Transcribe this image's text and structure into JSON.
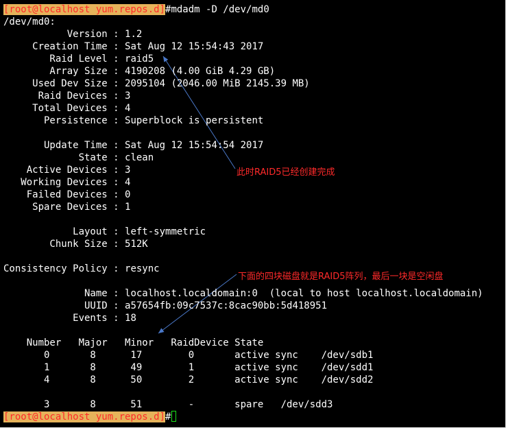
{
  "prompt": {
    "text": "[root@localhost yum.repos.d]",
    "symbol": "#"
  },
  "command": "mdadm -D /dev/md0",
  "device_header": "/dev/md0:",
  "details": [
    {
      "key": "Version",
      "value": "1.2"
    },
    {
      "key": "Creation Time",
      "value": "Sat Aug 12 15:54:43 2017"
    },
    {
      "key": "Raid Level",
      "value": "raid5"
    },
    {
      "key": "Array Size",
      "value": "4190208 (4.00 GiB 4.29 GB)"
    },
    {
      "key": "Used Dev Size",
      "value": "2095104 (2046.00 MiB 2145.39 MB)"
    },
    {
      "key": "Raid Devices",
      "value": "3"
    },
    {
      "key": "Total Devices",
      "value": "4"
    },
    {
      "key": "Persistence",
      "value": "Superblock is persistent"
    },
    {
      "key": "Update Time",
      "value": "Sat Aug 12 15:54:54 2017"
    },
    {
      "key": "State",
      "value": "clean"
    },
    {
      "key": "Active Devices",
      "value": "3"
    },
    {
      "key": "Working Devices",
      "value": "4"
    },
    {
      "key": "Failed Devices",
      "value": "0"
    },
    {
      "key": "Spare Devices",
      "value": "1"
    },
    {
      "key": "Layout",
      "value": "left-symmetric"
    },
    {
      "key": "Chunk Size",
      "value": "512K"
    },
    {
      "key": "Consistency Policy",
      "value": "resync"
    },
    {
      "key": "Name",
      "value": "localhost.localdomain:0  (local to host localhost.localdomain)"
    },
    {
      "key": "UUID",
      "value": "a57654fb:09c7537c:8cac90bb:5d418951"
    },
    {
      "key": "Events",
      "value": "18"
    }
  ],
  "device_table": {
    "headers": [
      "Number",
      "Major",
      "Minor",
      "RaidDevice",
      "State"
    ],
    "rows": [
      {
        "number": "0",
        "major": "8",
        "minor": "17",
        "raid_device": "0",
        "state": "active sync",
        "device": "/dev/sdb1"
      },
      {
        "number": "1",
        "major": "8",
        "minor": "49",
        "raid_device": "1",
        "state": "active sync",
        "device": "/dev/sdd1"
      },
      {
        "number": "4",
        "major": "8",
        "minor": "50",
        "raid_device": "2",
        "state": "active sync",
        "device": "/dev/sdd2"
      },
      {
        "number": "3",
        "major": "8",
        "minor": "51",
        "raid_device": "-",
        "state": "spare",
        "device": "/dev/sdd3"
      }
    ]
  },
  "annotations": {
    "raid_complete": "此时RAID5已经创建完成",
    "disk_note": "下面的四块磁盘就是RAID5阵列，最后一块是空闲盘"
  },
  "colors": {
    "terminal_bg": "#000000",
    "terminal_fg": "#ffffff",
    "prompt_bg": "#e6b35a",
    "prompt_fg": "#ff2a2a",
    "annotation": "#ff2a2a",
    "arrow": "#4a78c8",
    "cursor": "#19e019"
  }
}
